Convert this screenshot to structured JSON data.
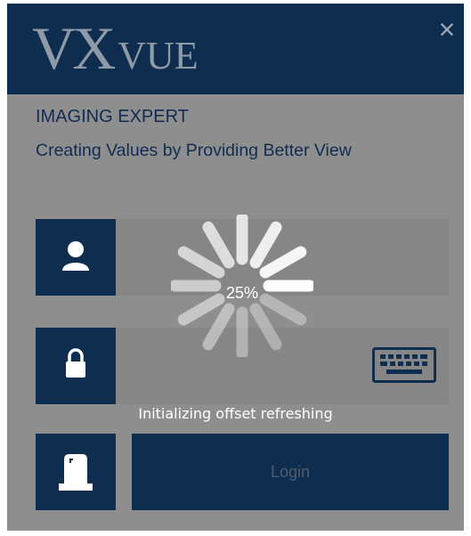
{
  "header": {
    "logo_vx": "VX",
    "logo_vue": "VUE",
    "close_label": "×"
  },
  "brand": {
    "title": "IMAGING EXPERT",
    "tagline": "Creating Values by Providing Better View"
  },
  "form": {
    "username_icon": "user-icon",
    "password_icon": "lock-icon",
    "keyboard_icon": "keyboard-icon",
    "badge_icon": "id-card-icon",
    "login_label": "Login"
  },
  "loading": {
    "percent_text": "25%",
    "progress": 0.25,
    "status_text": "Initializing offset refreshing"
  },
  "colors": {
    "navy": "#0f2d4f",
    "overlay_gray": "#8e8e8e",
    "brand_text": "#102c52"
  }
}
